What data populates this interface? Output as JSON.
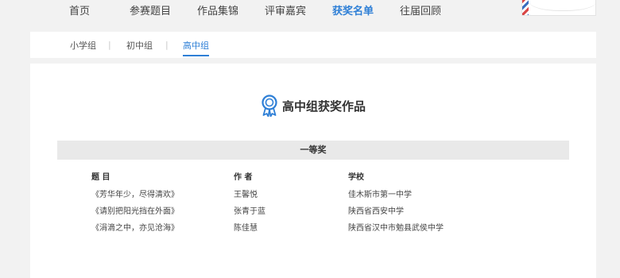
{
  "nav": {
    "items": [
      "首页",
      "参赛题目",
      "作品集锦",
      "评审嘉宾",
      "获奖名单",
      "往届回顾"
    ],
    "active_index": 4
  },
  "tabs": {
    "items": [
      "小学组",
      "初中组",
      "高中组"
    ],
    "separator": "|",
    "active_index": 2
  },
  "section": {
    "title": "高中组获奖作品",
    "icon": "award-ribbon-icon",
    "accent_color": "#2e7fd6"
  },
  "prize": {
    "name": "一等奖",
    "columns": [
      "题 目",
      "作 者",
      "学校"
    ],
    "rows": [
      [
        "《芳华年少，尽得清欢》",
        "王馨悦",
        "佳木斯市第一中学"
      ],
      [
        "《请别把阳光挡在外面》",
        "张青于蓝",
        "陕西省西安中学"
      ],
      [
        "《涓滴之中，亦见沧海》",
        "陈佳慧",
        "陕西省汉中市勉县武侯中学"
      ]
    ]
  }
}
